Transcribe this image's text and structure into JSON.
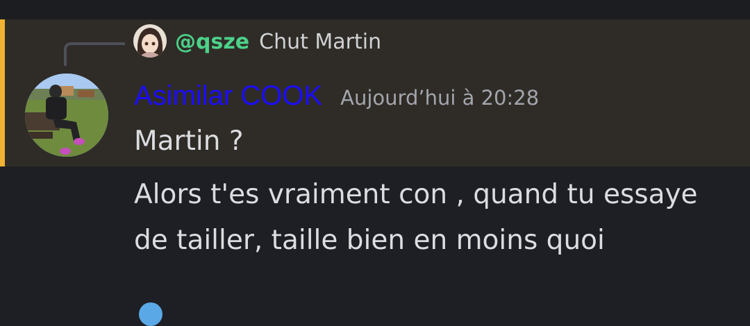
{
  "reply": {
    "mention": "@qsze",
    "text": "Chut Martin",
    "avatar_icon": "anime-avatar-icon"
  },
  "message": {
    "author": "Asimilar COOK",
    "author_color": "#1c0dff",
    "timestamp": "Aujourd’hui à 20:28",
    "avatar_icon": "user-photo-avatar"
  },
  "messages": [
    "Martin ?",
    "Alors t'es vraiment con , quand tu essaye",
    "de tailler, taille bien en moins quoi"
  ],
  "colors": {
    "highlight_bar": "#f0b232",
    "mention": "#4cd189",
    "background": "#1e1f24"
  }
}
